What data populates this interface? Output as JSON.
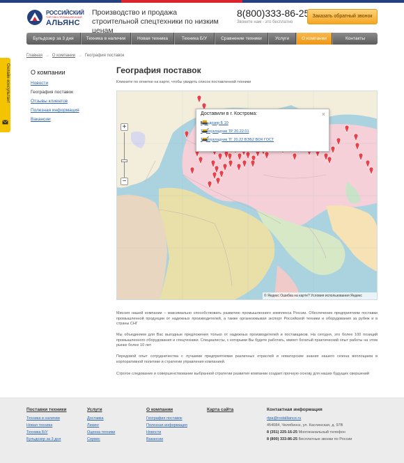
{
  "header": {
    "logo_line1": "РОССИЙСКИЙ",
    "logo_line2": "ТОРГОВО-ПРОМЫШЛЕННЫЙ",
    "logo_line3": "АЛЬЯНС",
    "tagline": "Производство и продажа строительной спецтехники по низким ценам",
    "phone": "8(800)333-86-25",
    "phone_note": "Звоните нам - это бесплатно",
    "callback_label": "Заказать обратный звонок"
  },
  "nav": {
    "items": [
      {
        "label": "Бульдозер за 3 дня",
        "active": false
      },
      {
        "label": "Техника в наличии",
        "active": false
      },
      {
        "label": "Новая техника",
        "active": false
      },
      {
        "label": "Техника Б/У",
        "active": false
      },
      {
        "label": "Сравнение техники",
        "active": false
      },
      {
        "label": "Услуги",
        "active": false
      },
      {
        "label": "О компании",
        "active": true
      },
      {
        "label": "Контакты",
        "active": false
      }
    ]
  },
  "breadcrumb": {
    "items": [
      "Главная",
      "О компании",
      "География поставок"
    ],
    "separator": "→"
  },
  "sidebar": {
    "title": "О компании",
    "items": [
      {
        "label": "Новости",
        "current": false
      },
      {
        "label": "География поставок",
        "current": true
      },
      {
        "label": "Отзывы клиентов",
        "current": false
      },
      {
        "label": "Полезная информация",
        "current": false
      },
      {
        "label": "Вакансии",
        "current": false
      }
    ]
  },
  "consultant_tab": {
    "label": "Онлайн-консультант",
    "icon": "envelope-icon"
  },
  "main": {
    "title": "География поставок",
    "intro": "Кликните по отметке на карте, чтобы увидеть список поставленной техники",
    "map": {
      "popup_title": "Доставили в г. Кострома:",
      "popup_items": [
        {
          "label": "Бульдозер Б 10",
          "icon": "bulldozer-icon"
        },
        {
          "label": "Трубоукладчик ТР 20.22.01",
          "icon": "pipelayer-icon"
        },
        {
          "label": "Трубоукладчик ТГ 20.22 ВЭБ2 ВОК ГОСТ",
          "icon": "pipelayer-icon"
        }
      ],
      "zoom_in": "+",
      "zoom_out": "−",
      "footer": "© Яндекс  Ошибка на карте?  Условия использования  Яндекс"
    },
    "paragraphs": [
      "Миссия нашей компании – максимально способствовать развитию промышленного комплекса России. Обеспечение предприятиям поставки промышленной продукции от надежных производителей, а также организовывая экспорт Российской техники и оборудования за рубеж и в страны СНГ",
      "Мы объединяем для Вас выгодные предложения только от надежных производителей и поставщиков. На сегодня, это более 100 позиций промышленного оборудования и спецтехники. Специалисты, с которыми Вы будете работать, имеют богатый практический опыт работы на этом рынке более 10 лет",
      "Передовой опыт сотрудничества с лучшими предприятиями различных отраслей и новаторские знания нашего сезона воплощаем в корпоративной политике и стратегии управления компанией.",
      "Строгое следование и совершенствование выбранной стратегии развития компании создает прочную основу для наших будущих свершений"
    ]
  },
  "footer": {
    "col1": {
      "head": "Поставки техники",
      "links": [
        "Техника в наличии",
        "Новая техника",
        "Техника Б/У",
        "Бульдозер за 3 дня"
      ]
    },
    "col2": {
      "head": "Услуги",
      "links": [
        "Доставка",
        "Лизинг",
        "Оценка техники",
        "Сервис"
      ]
    },
    "col3": {
      "head": "О компании",
      "links": [
        "География поставок",
        "Полезная информация",
        "Новости",
        "Вакансии"
      ]
    },
    "col4": {
      "head": "Карта сайта"
    },
    "col5": {
      "head": "Контактная информация",
      "email": "rtpa@rostalliance.ru",
      "address": "454084, Челябинск, ул. Каслинская, д. 97В",
      "phone1": "8 (351) 225-16-25",
      "phone1_note": "Многоканальный телефон",
      "phone2": "8 (800) 333-86-25",
      "phone2_note": "Бесплатные звонки по России"
    }
  },
  "colors": {
    "accent": "#f5a623",
    "link": "#2c64b0",
    "brand_blue": "#24407e",
    "brand_red": "#d9232d"
  }
}
